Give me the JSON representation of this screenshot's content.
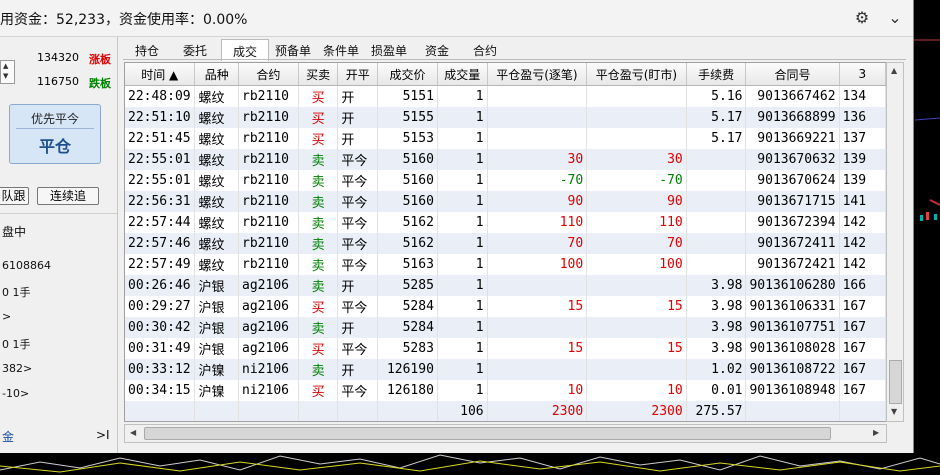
{
  "title": "用资金：52,233，资金使用率：0.00%",
  "icons": {
    "settings": "gear-icon",
    "collapse": "chevron-down-icon"
  },
  "left": {
    "limit_up_price": "134320",
    "limit_up_label": "涨板",
    "limit_down_price": "116750",
    "limit_down_label": "跌板",
    "priority_top": "优先平今",
    "priority_main": "平仓",
    "follow_button": "队跟",
    "continue_button": "连续追",
    "status": "盘中",
    "account": "6108864",
    "pos1": "0  1手",
    "arrow1": ">",
    "pos2": "0  1手",
    "line_382": "382>",
    "line_10": "-10>",
    "bottom_label": "金",
    "bottom_arrow": ">I"
  },
  "tabs": [
    "持仓",
    "委托",
    "成交",
    "预备单",
    "条件单",
    "损盈单",
    "资金",
    "合约"
  ],
  "active_tab": 2,
  "columns": [
    "时间 ▲",
    "品种",
    "合约",
    "买卖",
    "开平",
    "成交价",
    "成交量",
    "平仓盈亏(逐笔)",
    "平仓盈亏(盯市)",
    "手续费",
    "合同号",
    "3"
  ],
  "rows": [
    [
      "22:48:09",
      "螺纹",
      "rb2110",
      "买",
      "开",
      "5151",
      "1",
      "",
      "",
      "5.16",
      "9013667462",
      "134"
    ],
    [
      "22:51:10",
      "螺纹",
      "rb2110",
      "买",
      "开",
      "5155",
      "1",
      "",
      "",
      "5.17",
      "9013668899",
      "136"
    ],
    [
      "22:51:45",
      "螺纹",
      "rb2110",
      "买",
      "开",
      "5153",
      "1",
      "",
      "",
      "5.17",
      "9013669221",
      "137"
    ],
    [
      "22:55:01",
      "螺纹",
      "rb2110",
      "卖",
      "平今",
      "5160",
      "1",
      "30",
      "30",
      "",
      "9013670632",
      "139"
    ],
    [
      "22:55:01",
      "螺纹",
      "rb2110",
      "卖",
      "平今",
      "5160",
      "1",
      "-70",
      "-70",
      "",
      "9013670624",
      "139"
    ],
    [
      "22:56:31",
      "螺纹",
      "rb2110",
      "卖",
      "平今",
      "5160",
      "1",
      "90",
      "90",
      "",
      "9013671715",
      "141"
    ],
    [
      "22:57:44",
      "螺纹",
      "rb2110",
      "卖",
      "平今",
      "5162",
      "1",
      "110",
      "110",
      "",
      "9013672394",
      "142"
    ],
    [
      "22:57:46",
      "螺纹",
      "rb2110",
      "卖",
      "平今",
      "5162",
      "1",
      "70",
      "70",
      "",
      "9013672411",
      "142"
    ],
    [
      "22:57:49",
      "螺纹",
      "rb2110",
      "卖",
      "平今",
      "5163",
      "1",
      "100",
      "100",
      "",
      "9013672421",
      "142"
    ],
    [
      "00:26:46",
      "沪银",
      "ag2106",
      "卖",
      "开",
      "5285",
      "1",
      "",
      "",
      "3.98",
      "90136106280",
      "166"
    ],
    [
      "00:29:27",
      "沪银",
      "ag2106",
      "买",
      "平今",
      "5284",
      "1",
      "15",
      "15",
      "3.98",
      "90136106331",
      "167"
    ],
    [
      "00:30:42",
      "沪银",
      "ag2106",
      "卖",
      "开",
      "5284",
      "1",
      "",
      "",
      "3.98",
      "90136107751",
      "167"
    ],
    [
      "00:31:49",
      "沪银",
      "ag2106",
      "买",
      "平今",
      "5283",
      "1",
      "15",
      "15",
      "3.98",
      "90136108028",
      "167"
    ],
    [
      "00:33:12",
      "沪镍",
      "ni2106",
      "卖",
      "开",
      "126190",
      "1",
      "",
      "",
      "1.02",
      "90136108722",
      "167"
    ],
    [
      "00:34:15",
      "沪镍",
      "ni2106",
      "买",
      "平今",
      "126180",
      "1",
      "10",
      "10",
      "0.01",
      "90136108948",
      "167"
    ]
  ],
  "totals": {
    "volume": "106",
    "pnl_trade": "2300",
    "pnl_mark": "2300",
    "fee": "275.57"
  },
  "colors": {
    "buy": "#e00000",
    "sell": "#008000",
    "profit": "#e00000",
    "loss": "#008000",
    "row_alt": "#e9eef7"
  }
}
